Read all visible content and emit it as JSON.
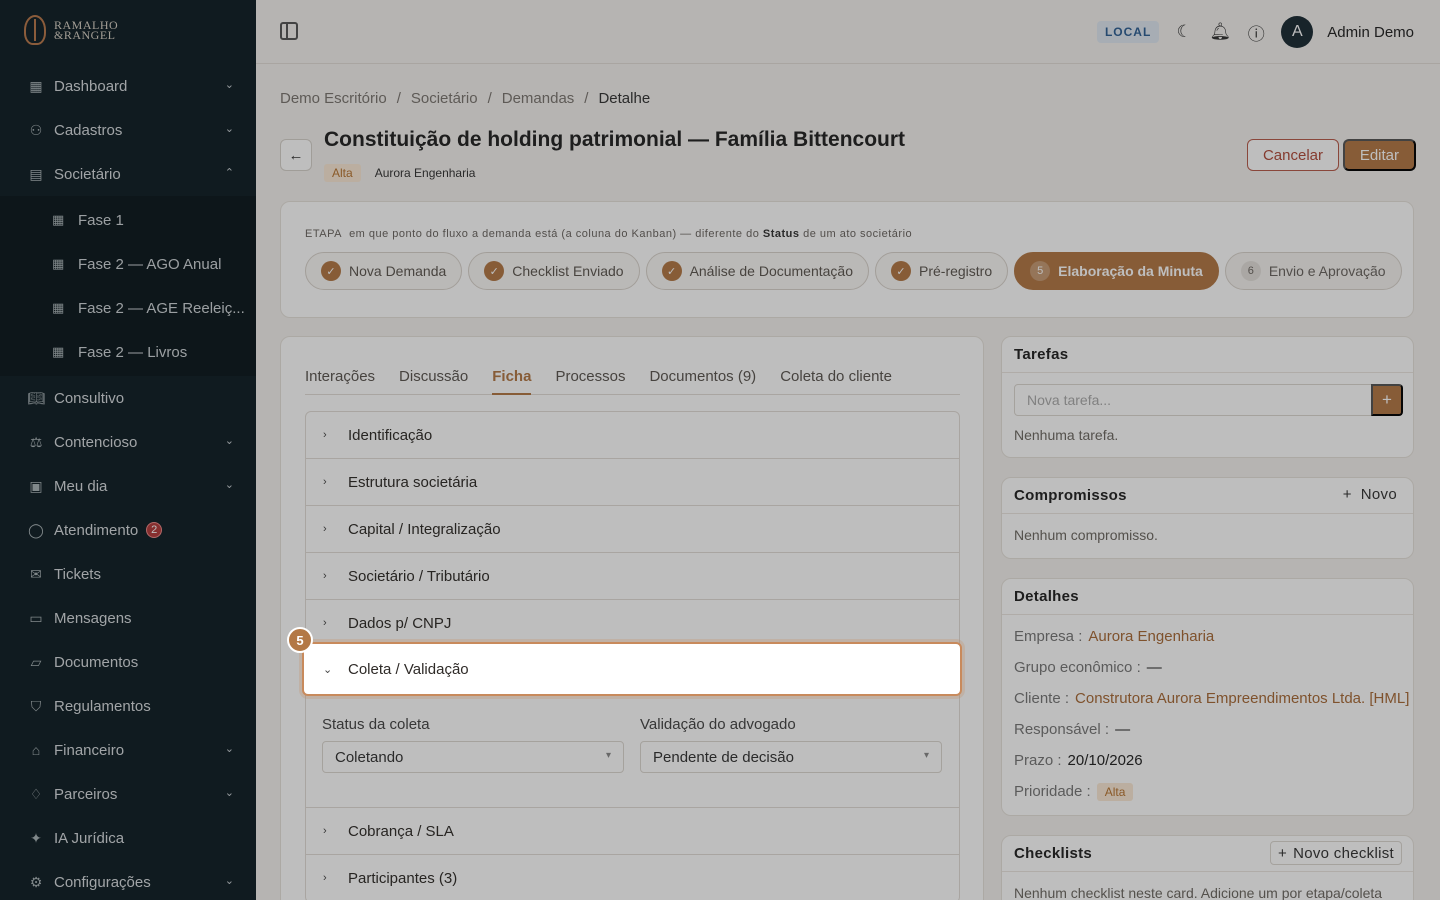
{
  "brand": {
    "line1": "RAMALHO",
    "line2": "&RANGEL"
  },
  "sidebar": {
    "items": [
      {
        "label": "Dashboard",
        "icon": "grid-icon"
      },
      {
        "label": "Cadastros",
        "icon": "users-icon"
      },
      {
        "label": "Societário",
        "icon": "building-icon"
      },
      {
        "label": "Consultivo",
        "icon": "book-icon"
      },
      {
        "label": "Contencioso",
        "icon": "scale-icon"
      },
      {
        "label": "Meu dia",
        "icon": "calendar-icon"
      },
      {
        "label": "Atendimento",
        "icon": "chat-icon",
        "badge": "2"
      },
      {
        "label": "Tickets",
        "icon": "ticket-icon"
      },
      {
        "label": "Mensagens",
        "icon": "message-icon"
      },
      {
        "label": "Documentos",
        "icon": "folder-icon"
      },
      {
        "label": "Regulamentos",
        "icon": "shield-icon"
      },
      {
        "label": "Financeiro",
        "icon": "bank-icon"
      },
      {
        "label": "Parceiros",
        "icon": "handshake-icon"
      },
      {
        "label": "IA Jurídica",
        "icon": "sparkle-icon"
      },
      {
        "label": "Configurações",
        "icon": "gear-icon"
      }
    ],
    "submenu": [
      "Fase 1",
      "Fase 2 — AGO Anual",
      "Fase 2 — AGE Reeleiç...",
      "Fase 2 — Livros"
    ]
  },
  "topbar": {
    "env": "LOCAL",
    "user_initial": "A",
    "user_name": "Admin Demo"
  },
  "breadcrumb": [
    "Demo Escritório",
    "Societário",
    "Demandas",
    "Detalhe"
  ],
  "header": {
    "title": "Constituição de holding patrimonial — Família Bittencourt",
    "priority": "Alta",
    "client": "Aurora Engenharia",
    "cancel_label": "Cancelar",
    "edit_label": "Editar"
  },
  "stages": {
    "hint_prefix": "ETAPA",
    "hint_text": "em que ponto do fluxo a demanda está (a coluna do Kanban) — diferente do",
    "hint_bold": "Status",
    "hint_suffix": "de um ato societário",
    "items": [
      {
        "label": "Nova Demanda",
        "state": "done"
      },
      {
        "label": "Checklist Enviado",
        "state": "done"
      },
      {
        "label": "Análise de Documentação",
        "state": "done"
      },
      {
        "label": "Pré-registro",
        "state": "done"
      },
      {
        "label": "Elaboração da Minuta",
        "state": "active",
        "num": "5"
      },
      {
        "label": "Envio e Aprovação",
        "state": "future",
        "num": "6"
      }
    ]
  },
  "tabs": [
    "Interações",
    "Discussão",
    "Ficha",
    "Processos",
    "Documentos (9)",
    "Coleta do cliente"
  ],
  "active_tab": "Ficha",
  "sections": {
    "before": [
      "Identificação",
      "Estrutura societária",
      "Capital / Integralização",
      "Societário / Tributário",
      "Dados p/ CNPJ"
    ],
    "expanded": "Coleta / Validação",
    "after": [
      "Cobrança / SLA",
      "Participantes (3)"
    ]
  },
  "coleta": {
    "status_label": "Status da coleta",
    "status_value": "Coletando",
    "validacao_label": "Validação do advogado",
    "validacao_value": "Pendente de decisão"
  },
  "tarefas": {
    "title": "Tarefas",
    "placeholder": "Nova tarefa...",
    "empty": "Nenhuma tarefa.",
    "add": "+"
  },
  "compromissos": {
    "title": "Compromissos",
    "new_label": "Novo",
    "empty": "Nenhum compromisso."
  },
  "detalhes": {
    "title": "Detalhes",
    "rows": [
      {
        "k": "Empresa :",
        "v": "Aurora Engenharia"
      },
      {
        "k": "Grupo econômico :",
        "v": "—"
      },
      {
        "k": "Cliente :",
        "v": "Construtora Aurora Empreendimentos Ltda. [HML]"
      },
      {
        "k": "Responsável :",
        "v": "—"
      },
      {
        "k": "Prazo :",
        "v": "20/10/2026"
      },
      {
        "k": "Prioridade :",
        "v": "Alta"
      }
    ]
  },
  "checklists": {
    "title": "Checklists",
    "new_label": "Novo checklist",
    "empty": "Nenhum checklist neste card. Adicione um por etapa/coleta"
  },
  "tour": {
    "step": "5"
  },
  "colors": {
    "accent": "#b37845",
    "sidebar_bg": "#0f1e24",
    "danger": "#b04a3a"
  }
}
